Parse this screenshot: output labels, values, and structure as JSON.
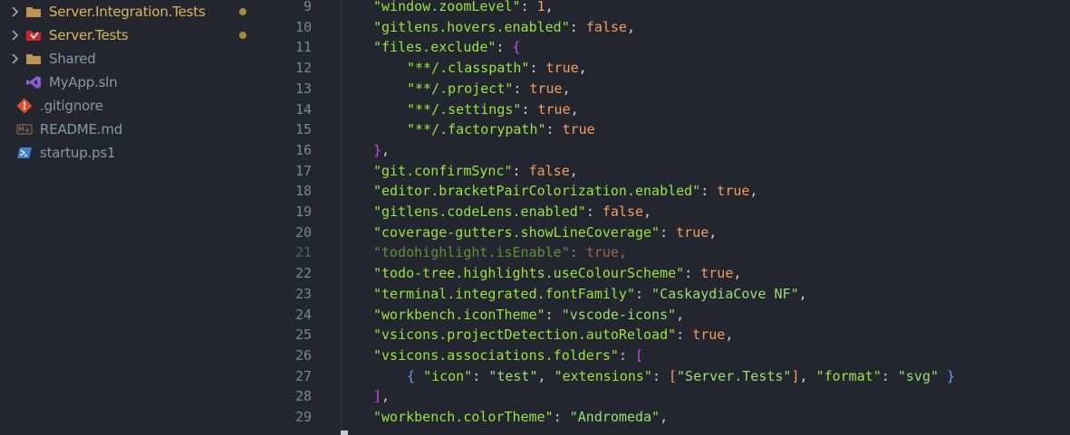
{
  "explorer": {
    "items": [
      {
        "label": "Server.Integration.Tests",
        "type": "folder",
        "icon": "folder-icon",
        "modified": true,
        "expandable": true
      },
      {
        "label": "Server.Tests",
        "type": "folder",
        "icon": "test-folder-icon",
        "modified": true,
        "expandable": true
      },
      {
        "label": "Shared",
        "type": "folder",
        "icon": "folder-icon",
        "modified": false,
        "expandable": true
      },
      {
        "label": "MyApp.sln",
        "type": "file",
        "icon": "visual-studio-icon",
        "modified": false,
        "expandable": false
      },
      {
        "label": ".gitignore",
        "type": "file",
        "icon": "git-icon",
        "modified": false,
        "expandable": false
      },
      {
        "label": "README.md",
        "type": "file",
        "icon": "markdown-icon",
        "modified": false,
        "expandable": false
      },
      {
        "label": "startup.ps1",
        "type": "file",
        "icon": "powershell-icon",
        "modified": false,
        "expandable": false
      }
    ]
  },
  "editor": {
    "lines": [
      {
        "n": "9",
        "indent": 0,
        "parts": [
          [
            "key",
            "\"window.zoomLevel\""
          ],
          [
            "pun",
            ": "
          ],
          [
            "bool",
            "1"
          ],
          [
            "pun",
            ","
          ]
        ]
      },
      {
        "n": "10",
        "indent": 0,
        "parts": [
          [
            "key",
            "\"gitlens.hovers.enabled\""
          ],
          [
            "pun",
            ": "
          ],
          [
            "bool",
            "false"
          ],
          [
            "pun",
            ","
          ]
        ]
      },
      {
        "n": "11",
        "indent": 0,
        "parts": [
          [
            "key",
            "\"files.exclude\""
          ],
          [
            "pun",
            ": "
          ],
          [
            "brace",
            "{"
          ]
        ]
      },
      {
        "n": "12",
        "indent": 1,
        "parts": [
          [
            "key",
            "\"**/.classpath\""
          ],
          [
            "pun",
            ": "
          ],
          [
            "bool",
            "true"
          ],
          [
            "pun",
            ","
          ]
        ]
      },
      {
        "n": "13",
        "indent": 1,
        "parts": [
          [
            "key",
            "\"**/.project\""
          ],
          [
            "pun",
            ": "
          ],
          [
            "bool",
            "true"
          ],
          [
            "pun",
            ","
          ]
        ]
      },
      {
        "n": "14",
        "indent": 1,
        "parts": [
          [
            "key",
            "\"**/.settings\""
          ],
          [
            "pun",
            ": "
          ],
          [
            "bool",
            "true"
          ],
          [
            "pun",
            ","
          ]
        ]
      },
      {
        "n": "15",
        "indent": 1,
        "parts": [
          [
            "key",
            "\"**/.factorypath\""
          ],
          [
            "pun",
            ": "
          ],
          [
            "bool",
            "true"
          ]
        ]
      },
      {
        "n": "16",
        "indent": 0,
        "parts": [
          [
            "brace",
            "}"
          ],
          [
            "pun",
            ","
          ]
        ]
      },
      {
        "n": "17",
        "indent": 0,
        "parts": [
          [
            "key",
            "\"git.confirmSync\""
          ],
          [
            "pun",
            ": "
          ],
          [
            "bool",
            "false"
          ],
          [
            "pun",
            ","
          ]
        ]
      },
      {
        "n": "18",
        "indent": 0,
        "parts": [
          [
            "key",
            "\"editor.bracketPairColorization.enabled\""
          ],
          [
            "pun",
            ": "
          ],
          [
            "bool",
            "true"
          ],
          [
            "pun",
            ","
          ]
        ]
      },
      {
        "n": "19",
        "indent": 0,
        "parts": [
          [
            "key",
            "\"gitlens.codeLens.enabled\""
          ],
          [
            "pun",
            ": "
          ],
          [
            "bool",
            "false"
          ],
          [
            "pun",
            ","
          ]
        ]
      },
      {
        "n": "20",
        "indent": 0,
        "parts": [
          [
            "key",
            "\"coverage-gutters.showLineCoverage\""
          ],
          [
            "pun",
            ": "
          ],
          [
            "bool",
            "true"
          ],
          [
            "pun",
            ","
          ]
        ]
      },
      {
        "n": "21",
        "indent": 0,
        "dim": true,
        "parts": [
          [
            "key",
            "\"todohighlight.isEnable\""
          ],
          [
            "pun",
            ": "
          ],
          [
            "bool",
            "true"
          ],
          [
            "pun",
            ","
          ]
        ]
      },
      {
        "n": "22",
        "indent": 0,
        "parts": [
          [
            "key",
            "\"todo-tree.highlights.useColourScheme\""
          ],
          [
            "pun",
            ": "
          ],
          [
            "bool",
            "true"
          ],
          [
            "pun",
            ","
          ]
        ]
      },
      {
        "n": "23",
        "indent": 0,
        "parts": [
          [
            "key",
            "\"terminal.integrated.fontFamily\""
          ],
          [
            "pun",
            ": "
          ],
          [
            "str",
            "\"CaskaydiaCove NF\""
          ],
          [
            "pun",
            ","
          ]
        ]
      },
      {
        "n": "24",
        "indent": 0,
        "parts": [
          [
            "key",
            "\"workbench.iconTheme\""
          ],
          [
            "pun",
            ": "
          ],
          [
            "str",
            "\"vscode-icons\""
          ],
          [
            "pun",
            ","
          ]
        ]
      },
      {
        "n": "25",
        "indent": 0,
        "parts": [
          [
            "key",
            "\"vsicons.projectDetection.autoReload\""
          ],
          [
            "pun",
            ": "
          ],
          [
            "bool",
            "true"
          ],
          [
            "pun",
            ","
          ]
        ]
      },
      {
        "n": "26",
        "indent": 0,
        "parts": [
          [
            "key",
            "\"vsicons.associations.folders\""
          ],
          [
            "pun",
            ": "
          ],
          [
            "brace",
            "["
          ]
        ]
      },
      {
        "n": "27",
        "indent": 1,
        "parts": [
          [
            "brace2",
            "{ "
          ],
          [
            "key",
            "\"icon\""
          ],
          [
            "pun",
            ": "
          ],
          [
            "str",
            "\"test\""
          ],
          [
            "pun",
            ", "
          ],
          [
            "key",
            "\"extensions\""
          ],
          [
            "pun",
            ": "
          ],
          [
            "brack",
            "["
          ],
          [
            "str",
            "\"Server.Tests\""
          ],
          [
            "brack",
            "]"
          ],
          [
            "pun",
            ", "
          ],
          [
            "key",
            "\"format\""
          ],
          [
            "pun",
            ": "
          ],
          [
            "str",
            "\"svg\""
          ],
          [
            "brace2",
            " }"
          ]
        ]
      },
      {
        "n": "28",
        "indent": 0,
        "parts": [
          [
            "brace",
            "]"
          ],
          [
            "pun",
            ","
          ]
        ]
      },
      {
        "n": "29",
        "indent": 0,
        "parts": [
          [
            "key",
            "\"workbench.colorTheme\""
          ],
          [
            "pun",
            ": "
          ],
          [
            "str",
            "\"Andromeda\""
          ],
          [
            "pun",
            ","
          ]
        ]
      }
    ]
  },
  "colors": {
    "background": "#23262e",
    "key": "#98e342",
    "string": "#96e072",
    "boolean": "#f39c5f",
    "brace": "#c74ded",
    "modified_label": "#d9b75b"
  }
}
